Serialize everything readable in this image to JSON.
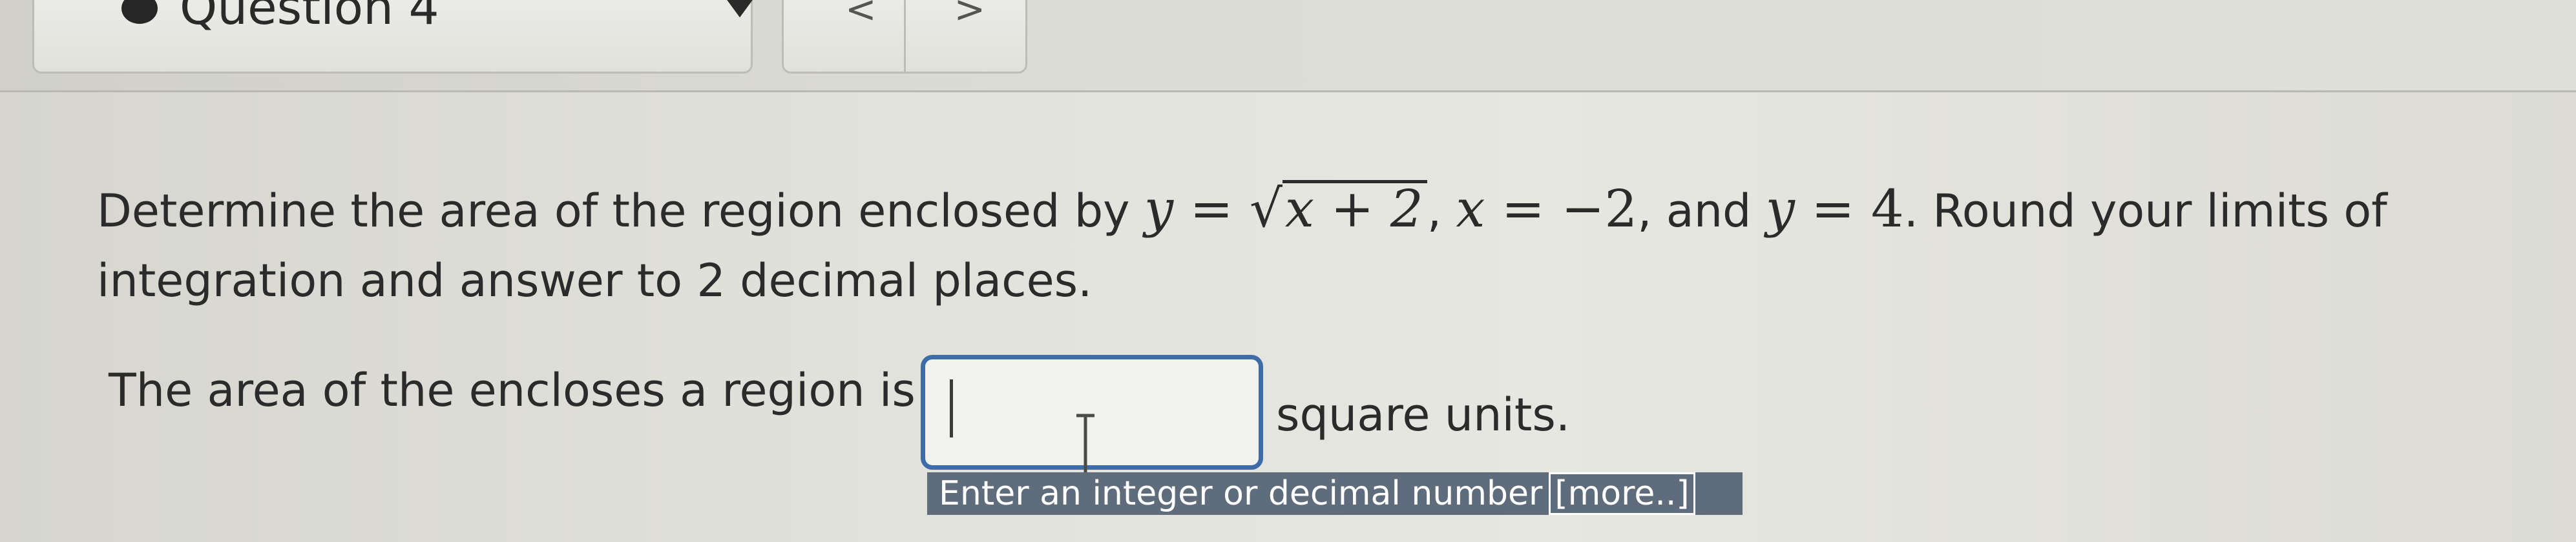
{
  "header": {
    "question_label": "Question 4",
    "prev_label": "<",
    "next_label": ">"
  },
  "problem": {
    "intro": "Determine the area of the region enclosed by ",
    "eq1_lhs": "y",
    "eq_sign": " = ",
    "radicand": "x + 2",
    "sep1": ", ",
    "eq2_lhs": "x",
    "eq2_rhs": "−2",
    "sep2": ", and ",
    "eq3_lhs": "y",
    "eq3_rhs": "4",
    "outro": ". Round your limits of integration and answer to 2 decimal places."
  },
  "answer": {
    "prompt": "The area of the encloses a region is",
    "input_value": "",
    "units": "square units.",
    "hint": "Enter an integer or decimal number",
    "more_label": "[more..]"
  },
  "colors": {
    "input_border": "#3d6ca8",
    "hint_background": "#5f6c7b"
  }
}
